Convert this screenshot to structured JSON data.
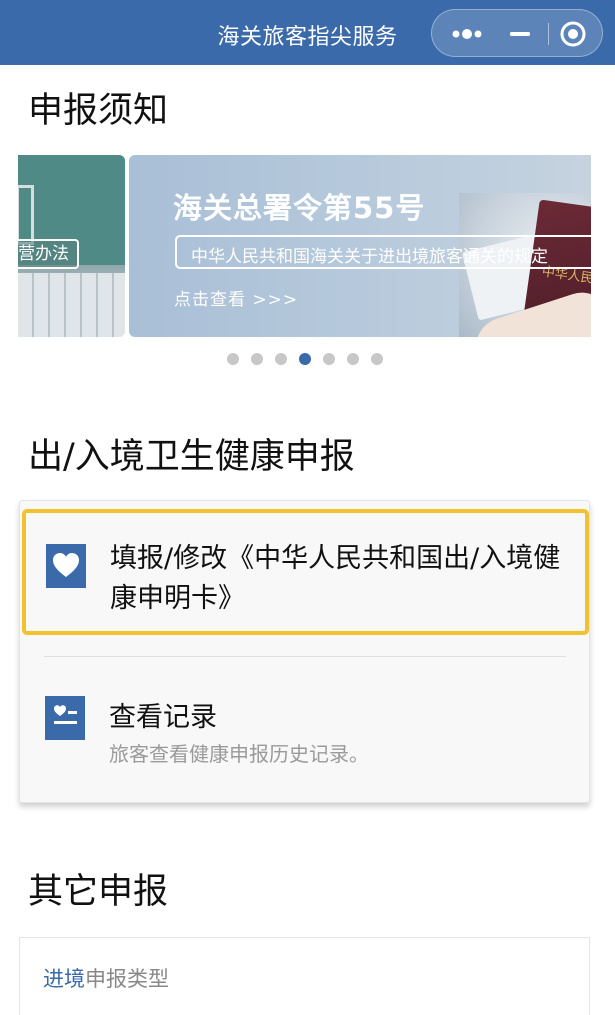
{
  "header": {
    "title": "海关旅客指尖服务",
    "bg_color": "#3a6aa9",
    "more_icon": "more-dots-icon",
    "minimize_icon": "minimize-icon",
    "close_icon": "target-close-icon"
  },
  "notice": {
    "title": "申报须知",
    "carousel": {
      "prev_slide_tag": "营办法",
      "current_slide": {
        "headline": "海关总署令第55号",
        "subtitle": "中华人民共和国海关关于进出境旅客通关的规定",
        "more_label": "点击查看 >>>",
        "passport_text": "中华人民共"
      },
      "dot_count": 7,
      "active_dot": 4
    }
  },
  "health": {
    "title": "出/入境卫生健康申报",
    "fill_item": {
      "label": "填报/修改《中华人民共和国出/入境健康申明卡》",
      "icon": "heart-icon",
      "highlight_color": "#f2c12e"
    },
    "record_item": {
      "title": "查看记录",
      "desc": "旅客查看健康申报历史记录。",
      "icon": "health-record-icon"
    }
  },
  "other": {
    "title": "其它申报",
    "type_highlight": "进境",
    "type_rest": "申报类型"
  }
}
